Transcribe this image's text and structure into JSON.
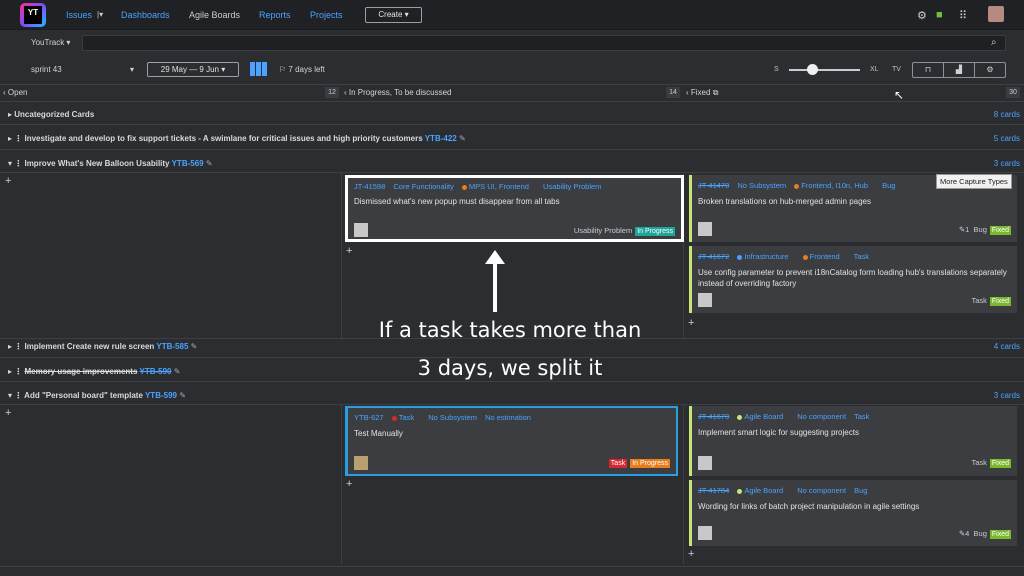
{
  "app": {
    "logo_text": "YT"
  },
  "nav": {
    "issues": "Issues",
    "dashboards": "Dashboards",
    "agile_boards": "Agile Boards",
    "reports": "Reports",
    "projects": "Projects",
    "create": "Create ▾"
  },
  "search": {
    "context": "YouTrack"
  },
  "filter": {
    "sprint": "sprint 43",
    "date_range": "29 May — 9 Jun",
    "days_left": "7 days left",
    "size_s": "S",
    "size_xl": "XL",
    "size_tv": "TV"
  },
  "columns": [
    {
      "label": "Open",
      "count": "12"
    },
    {
      "label": "In Progress, To be discussed",
      "count": "14"
    },
    {
      "label": "Fixed",
      "count": "30"
    }
  ],
  "swimlanes": [
    {
      "title": "Uncategorized Cards",
      "id": "",
      "cards": "8 cards"
    },
    {
      "title": "Investigate and develop to fix support tickets - A swimlane for critical issues and high priority customers",
      "id": "YTB-422",
      "cards": "5 cards"
    },
    {
      "title": "Improve What's New Balloon Usability",
      "id": "YTB-569",
      "cards": "3 cards"
    },
    {
      "title": "Implement Create new rule screen",
      "id": "YTB-585",
      "cards": "4 cards"
    },
    {
      "title": "Memory usage improvements",
      "id": "YTB-590",
      "cards": ""
    },
    {
      "title": "Add \"Personal board\" template",
      "id": "YTB-599",
      "cards": "3 cards"
    }
  ],
  "cards": {
    "c1": {
      "id": "JT-41598",
      "sub": "Core Functionality",
      "comp": "MPS UI, Frontend",
      "type": "Usability Problem",
      "summary": "Dismissed what's new popup must disappear from all tabs",
      "tagtext": "Usability Problem",
      "state": "In Progress"
    },
    "c2": {
      "id": "JT-41470",
      "sub": "No Subsystem",
      "comp": "Frontend, I10n, Hub",
      "type": "Bug",
      "summary": "Broken translations on hub-merged admin pages",
      "comments": "1",
      "tagtext": "Bug",
      "state": "Fixed"
    },
    "c3": {
      "id": "JT-41672",
      "sub": "Infrastructure",
      "comp": "Frontend",
      "type": "Task",
      "summary": "Use config parameter to prevent i18nCatalog form loading hub's translations separately instead of overriding factory",
      "tagtext": "Task",
      "state": "Fixed"
    },
    "c4": {
      "id": "YTB-627",
      "sub": "Task",
      "comp": "No Subsystem",
      "type": "No estimation",
      "summary": "Test Manually",
      "tagtext": "Task",
      "state": "In Progress"
    },
    "c5": {
      "id": "JT-41670",
      "sub": "Agile Board",
      "comp": "No component",
      "type": "Task",
      "summary": "Implement smart logic for suggesting projects",
      "tagtext": "Task",
      "state": "Fixed"
    },
    "c6": {
      "id": "JT-41784",
      "sub": "Agile Board",
      "comp": "No component",
      "type": "Bug",
      "summary": "Wording for links of batch project manipulation in agile settings",
      "comments": "4",
      "tagtext": "Bug",
      "state": "Fixed"
    }
  },
  "tooltip": "More Capture Types",
  "annotation": {
    "line1": "If a task takes more than",
    "line2": "3 days, we split it"
  },
  "colors": {
    "accent": "#4aa3ff",
    "fixed": "#7cb82f",
    "inprogress_teal": "#1ea69a",
    "inprogress_orange": "#e87d1e",
    "task_red": "#d7282f"
  }
}
